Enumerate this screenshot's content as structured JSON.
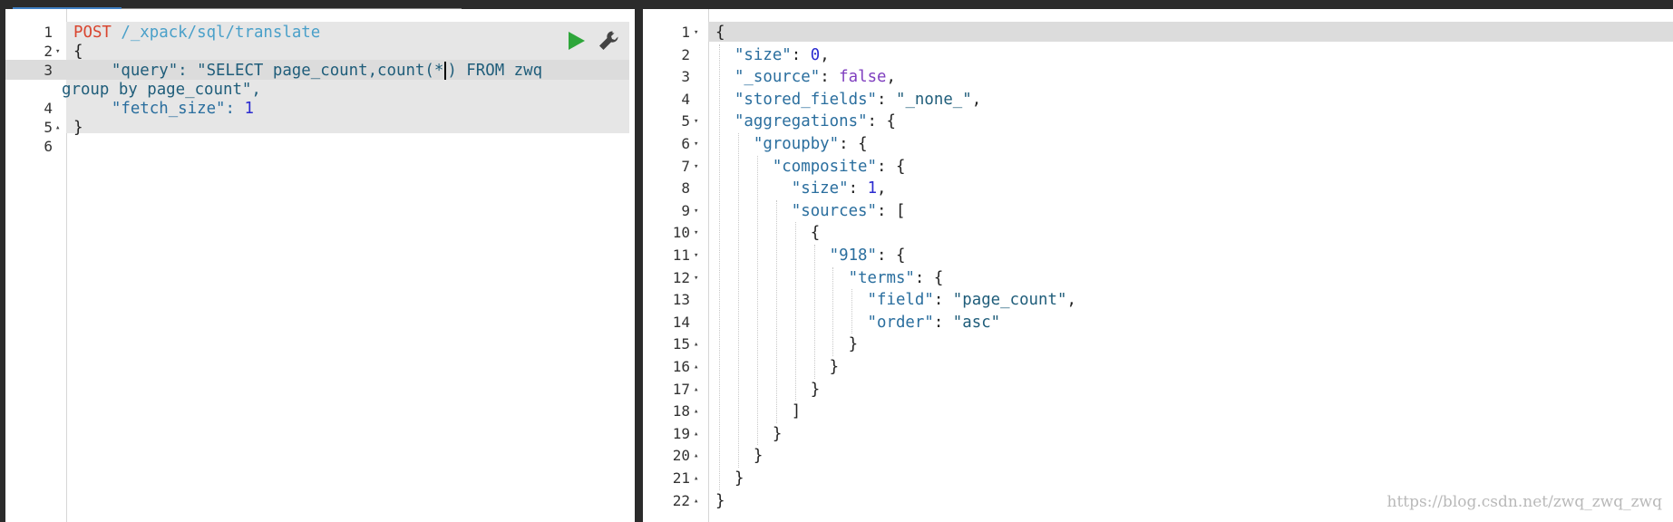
{
  "left_editor": {
    "lines": [
      {
        "num": "1",
        "text_method": "POST",
        "text_path": " /_xpack/sql/translate"
      },
      {
        "num": "2",
        "text": "{"
      },
      {
        "num": "3",
        "text_a": "    \"query\": \"SELECT page_count,count(*",
        "text_b": ") FROM zwq",
        "text_c": "group by page_count\","
      },
      {
        "num": "4",
        "text": "    \"fetch_size\": ",
        "val": "1"
      },
      {
        "num": "5",
        "text": "}"
      },
      {
        "num": "6",
        "text": ""
      }
    ]
  },
  "right_editor": {
    "lines": [
      {
        "num": "1",
        "html": "{"
      },
      {
        "num": "2",
        "html": "  \"size\": 0,"
      },
      {
        "num": "3",
        "html": "  \"_source\": false,"
      },
      {
        "num": "4",
        "html": "  \"stored_fields\": \"_none_\","
      },
      {
        "num": "5",
        "html": "  \"aggregations\": {"
      },
      {
        "num": "6",
        "html": "    \"groupby\": {"
      },
      {
        "num": "7",
        "html": "      \"composite\": {"
      },
      {
        "num": "8",
        "html": "        \"size\": 1,"
      },
      {
        "num": "9",
        "html": "        \"sources\": ["
      },
      {
        "num": "10",
        "html": "          {"
      },
      {
        "num": "11",
        "html": "            \"918\": {"
      },
      {
        "num": "12",
        "html": "              \"terms\": {"
      },
      {
        "num": "13",
        "html": "                \"field\": \"page_count\","
      },
      {
        "num": "14",
        "html": "                \"order\": \"asc\""
      },
      {
        "num": "15",
        "html": "              }"
      },
      {
        "num": "16",
        "html": "            }"
      },
      {
        "num": "17",
        "html": "          }"
      },
      {
        "num": "18",
        "html": "        ]"
      },
      {
        "num": "19",
        "html": "      }"
      },
      {
        "num": "20",
        "html": "    }"
      },
      {
        "num": "21",
        "html": "  }"
      },
      {
        "num": "22",
        "html": "}"
      }
    ]
  },
  "watermark": "https://blog.csdn.net/zwq_zwq_zwq",
  "colors": {
    "play": "#2ea63a",
    "wrench": "#444444"
  }
}
